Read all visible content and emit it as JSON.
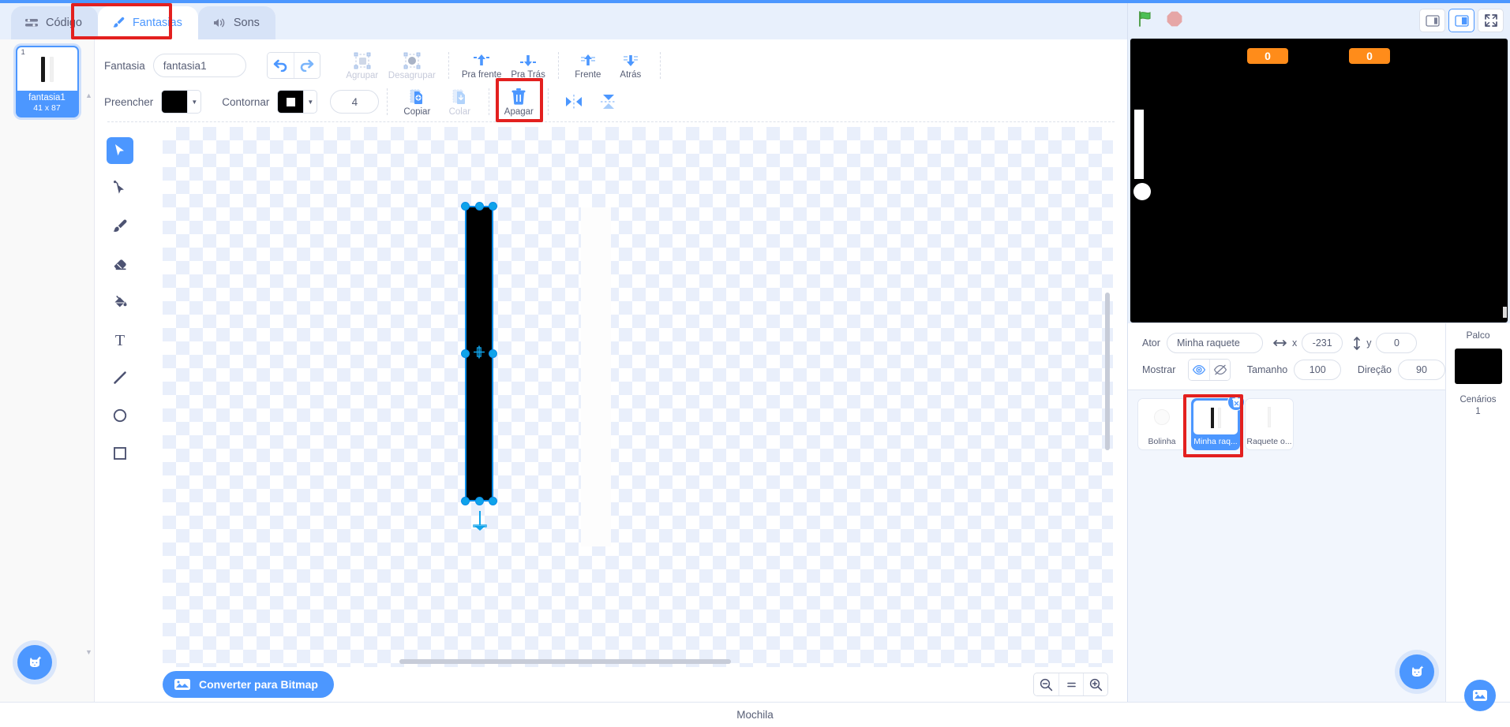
{
  "tabs": [
    {
      "label": "Código",
      "icon": "code-icon",
      "active": false
    },
    {
      "label": "Fantasias",
      "icon": "paintbrush-icon",
      "active": true
    },
    {
      "label": "Sons",
      "icon": "speaker-icon",
      "active": false
    }
  ],
  "costumes": {
    "items": [
      {
        "number": "1",
        "name": "fantasia1",
        "size": "41 x 87",
        "selected": true
      }
    ],
    "add_button_label": "add-costume"
  },
  "paint_toolbar": {
    "costume_label": "Fantasia",
    "costume_name": "fantasia1",
    "undo_label": "undo",
    "redo_label": "redo",
    "group_label": "Agrupar",
    "ungroup_label": "Desagrupar",
    "forward_label": "Pra frente",
    "backward_label": "Pra Trás",
    "front_label": "Frente",
    "back_label": "Atrás",
    "fill_label": "Preencher",
    "fill_color": "#000000",
    "stroke_label": "Contornar",
    "stroke_color": "#000000",
    "stroke_width": "4",
    "copy_label": "Copiar",
    "paste_label": "Colar",
    "delete_label": "Apagar",
    "flip_h_label": "flip-horizontal",
    "flip_v_label": "flip-vertical"
  },
  "tools": [
    {
      "name": "select-tool",
      "active": true
    },
    {
      "name": "reshape-tool",
      "active": false
    },
    {
      "name": "brush-tool",
      "active": false
    },
    {
      "name": "eraser-tool",
      "active": false
    },
    {
      "name": "fill-tool",
      "active": false
    },
    {
      "name": "text-tool",
      "active": false
    },
    {
      "name": "line-tool",
      "active": false
    },
    {
      "name": "circle-tool",
      "active": false
    },
    {
      "name": "rectangle-tool",
      "active": false
    }
  ],
  "canvas_footer": {
    "bitmap_button": "Converter para Bitmap",
    "zoom_out": "zoom-out",
    "zoom_reset": "=",
    "zoom_in": "zoom-in"
  },
  "stage": {
    "green_flag": "green-flag",
    "stop_sign": "stop-sign",
    "small_stage": "small-stage-layout",
    "large_stage": "large-stage-layout",
    "fullscreen": "fullscreen",
    "monitors": [
      {
        "value": "0"
      },
      {
        "value": "0"
      }
    ],
    "background_color": "#000000"
  },
  "sprite_info": {
    "sprite_label": "Ator",
    "sprite_name": "Minha raquete",
    "x_label": "x",
    "x_value": "-231",
    "y_label": "y",
    "y_value": "0",
    "show_label": "Mostrar",
    "size_label": "Tamanho",
    "size_value": "100",
    "direction_label": "Direção",
    "direction_value": "90"
  },
  "sprites": [
    {
      "name": "Bolinha",
      "selected": false,
      "thumb": "ball"
    },
    {
      "name": "Minha raq...",
      "selected": true,
      "thumb": "paddle-pair",
      "highlighted": true
    },
    {
      "name": "Raquete o...",
      "selected": false,
      "thumb": "paddle"
    }
  ],
  "stage_panel": {
    "title": "Palco",
    "backdrops_label": "Cenários",
    "backdrops_count": "1"
  },
  "bottom_bar": {
    "backpack_label": "Mochila"
  },
  "highlight_color": "#e3201f",
  "accent_color": "#4c97ff"
}
